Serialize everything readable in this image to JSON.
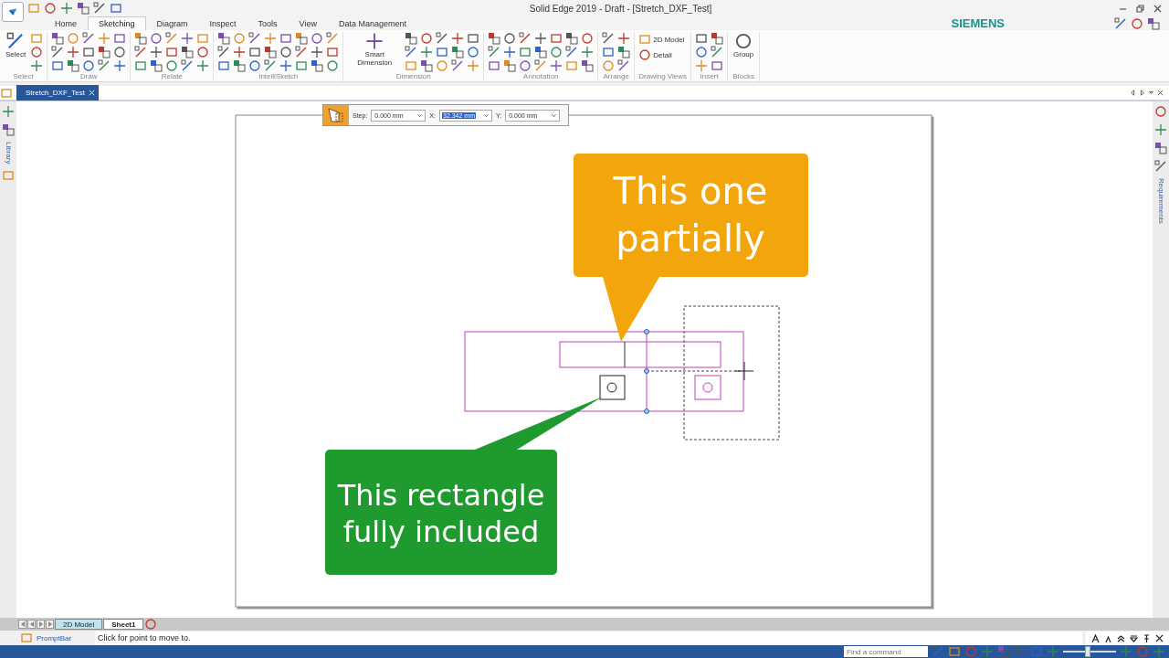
{
  "title_bar": {
    "title": "Solid Edge 2019 - Draft - [Stretch_DXF_Test]"
  },
  "ribbon_tabs": [
    {
      "label": "Home",
      "selected": false
    },
    {
      "label": "Sketching",
      "selected": true
    },
    {
      "label": "Diagram",
      "selected": false
    },
    {
      "label": "Inspect",
      "selected": false
    },
    {
      "label": "Tools",
      "selected": false
    },
    {
      "label": "View",
      "selected": false
    },
    {
      "label": "Data Management",
      "selected": false
    }
  ],
  "brand": "SIEMENS",
  "ribbon_groups": [
    {
      "label": "Select",
      "big_button": "Select"
    },
    {
      "label": "Draw"
    },
    {
      "label": "Relate"
    },
    {
      "label": "IntelliSketch"
    },
    {
      "label": "Dimension",
      "big_button": "Smart Dimension"
    },
    {
      "label": "Annotation"
    },
    {
      "label": "Arrange"
    },
    {
      "label": "Drawing Views",
      "text_buttons": [
        "2D Model",
        "Detail"
      ]
    },
    {
      "label": "Insert"
    },
    {
      "label": "Blocks",
      "big_button": "Group"
    }
  ],
  "document_tabs": [
    {
      "label": "Stretch_DXF_Test",
      "selected": true
    }
  ],
  "side_panels": {
    "left": "Library",
    "right": "Requirements"
  },
  "move_toolbar": {
    "fields": [
      {
        "label": "Step:",
        "value": "0.000 mm",
        "selected": false
      },
      {
        "label": "X:",
        "value": "32.342 mm",
        "selected": true
      },
      {
        "label": "Y:",
        "value": "0.000 mm",
        "selected": false
      }
    ]
  },
  "callouts": [
    {
      "lines": [
        "This one",
        "partially"
      ],
      "color": "#f2a60c"
    },
    {
      "lines": [
        "This rectangle",
        "fully included"
      ],
      "color": "#1f9a2e"
    }
  ],
  "sheet_tabs": [
    {
      "label": "2D Model",
      "selected": false
    },
    {
      "label": "Sheet1",
      "selected": true
    }
  ],
  "prompt_bar": {
    "label": "PromptBar",
    "message": "Click for point to move to."
  },
  "status_bar": {
    "command_search": {
      "placeholder": "Find a command"
    },
    "zoom": {
      "level": 0.47
    }
  }
}
